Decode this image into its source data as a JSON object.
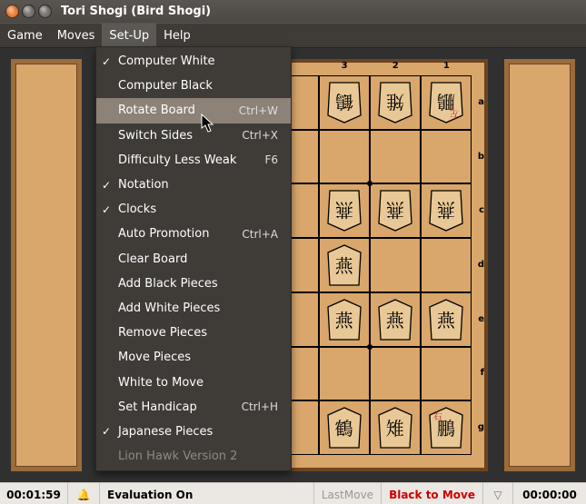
{
  "title": "Tori Shogi  (Bird Shogi)",
  "menus": {
    "game": "Game",
    "moves": "Moves",
    "setup": "Set-Up",
    "help": "Help"
  },
  "setup_menu": [
    {
      "label": "Computer White",
      "checked": true
    },
    {
      "label": "Computer Black"
    },
    {
      "label": "Rotate Board",
      "accel": "Ctrl+W",
      "highlight": true
    },
    {
      "label": "Switch Sides",
      "accel": "Ctrl+X"
    },
    {
      "label": "Difficulty Less Weak",
      "accel": "F6"
    },
    {
      "label": "Notation",
      "checked": true
    },
    {
      "label": "Clocks",
      "checked": true
    },
    {
      "label": "Auto Promotion",
      "accel": "Ctrl+A"
    },
    {
      "label": "Clear Board"
    },
    {
      "label": "Add Black Pieces"
    },
    {
      "label": "Add White Pieces"
    },
    {
      "label": "Remove Pieces"
    },
    {
      "label": "Move Pieces"
    },
    {
      "label": "White to Move"
    },
    {
      "label": "Set Handicap",
      "accel": "Ctrl+H"
    },
    {
      "label": "Japanese Pieces",
      "checked": true
    },
    {
      "label": "Lion Hawk Version 2",
      "disabled": true
    }
  ],
  "status": {
    "timer_left": "00:01:59",
    "bell": "🔔",
    "eval": "Evaluation On",
    "last": "LastMove",
    "to_move": "Black to Move",
    "timer_right": "00:00:00"
  },
  "board": {
    "visible_cols": [
      3,
      2,
      1
    ],
    "visible_rows": [
      "a",
      "b",
      "c",
      "d",
      "e",
      "f",
      "g"
    ],
    "pieces": [
      {
        "col": 3,
        "row": "a",
        "glyph": "鶴",
        "down": true
      },
      {
        "col": 2,
        "row": "a",
        "glyph": "雉",
        "down": true
      },
      {
        "col": 1,
        "row": "a",
        "glyph": "鵬",
        "down": true,
        "red_overlay": "左"
      },
      {
        "col": 3,
        "row": "c",
        "glyph": "燕",
        "down": true
      },
      {
        "col": 2,
        "row": "c",
        "glyph": "燕",
        "down": true
      },
      {
        "col": 1,
        "row": "c",
        "glyph": "燕",
        "down": true
      },
      {
        "col": 3,
        "row": "d",
        "glyph": "燕"
      },
      {
        "col": 3,
        "row": "e",
        "glyph": "燕"
      },
      {
        "col": 2,
        "row": "e",
        "glyph": "燕"
      },
      {
        "col": 1,
        "row": "e",
        "glyph": "燕"
      },
      {
        "col": 3,
        "row": "g",
        "glyph": "鶴"
      },
      {
        "col": 2,
        "row": "g",
        "glyph": "雉"
      },
      {
        "col": 1,
        "row": "g",
        "glyph": "鵬",
        "red_overlay": "右"
      }
    ]
  }
}
